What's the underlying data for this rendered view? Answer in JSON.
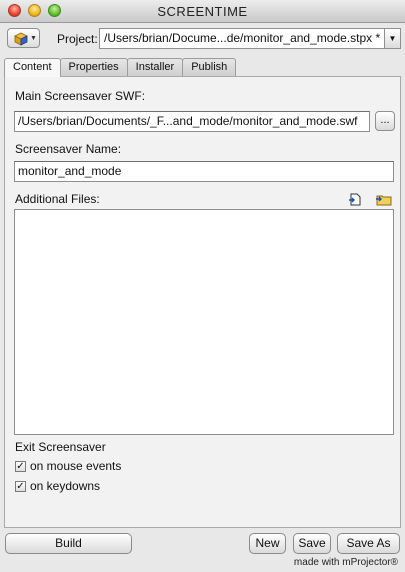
{
  "window": {
    "title": "SCREENTIME"
  },
  "project": {
    "label": "Project:",
    "path": "/Users/brian/Docume...de/monitor_and_mode.stpx *"
  },
  "tabs": [
    {
      "label": "Content",
      "active": true
    },
    {
      "label": "Properties",
      "active": false
    },
    {
      "label": "Installer",
      "active": false
    },
    {
      "label": "Publish",
      "active": false
    }
  ],
  "content": {
    "main_swf_label": "Main Screensaver SWF:",
    "main_swf_value": "/Users/brian/Documents/_F...and_mode/monitor_and_mode.swf",
    "browse_label": "...",
    "name_label": "Screensaver Name:",
    "name_value": "monitor_and_mode",
    "additional_files_label": "Additional Files:",
    "exit_label": "Exit Screensaver",
    "mouse_events_label": "on mouse events",
    "mouse_events_checked": true,
    "keydowns_label": "on keydowns",
    "keydowns_checked": true
  },
  "buttons": {
    "build": "Build",
    "new": "New",
    "save": "Save",
    "save_as": "Save As"
  },
  "footer": "made with mProjector®",
  "icons": {
    "project_icon": "cube-icon",
    "add_file": "add-file-icon",
    "add_folder": "add-folder-icon"
  }
}
